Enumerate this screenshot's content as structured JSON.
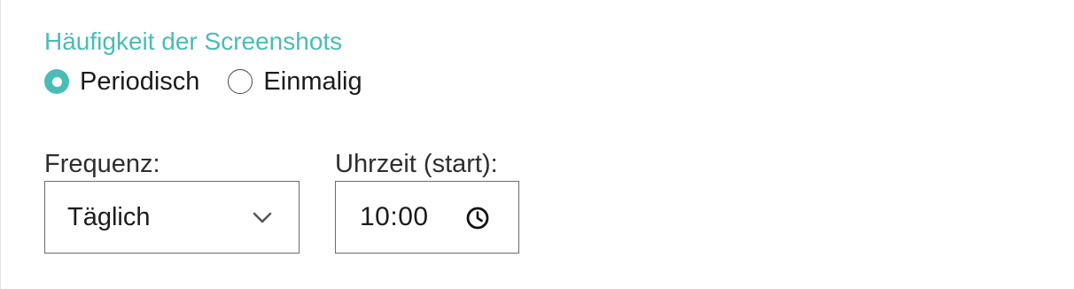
{
  "section": {
    "title": "Häufigkeit der Screenshots"
  },
  "mode_options": [
    {
      "label": "Periodisch",
      "checked": true
    },
    {
      "label": "Einmalig",
      "checked": false
    }
  ],
  "frequency": {
    "label": "Frequenz:",
    "value": "Täglich",
    "icon": "chevron-down-icon"
  },
  "start_time": {
    "label": "Uhrzeit (start):",
    "value": "10:00",
    "icon": "clock-icon"
  },
  "colors": {
    "accent": "#4bbcb5",
    "text": "#1b1b1b",
    "border": "#6b6b73"
  }
}
